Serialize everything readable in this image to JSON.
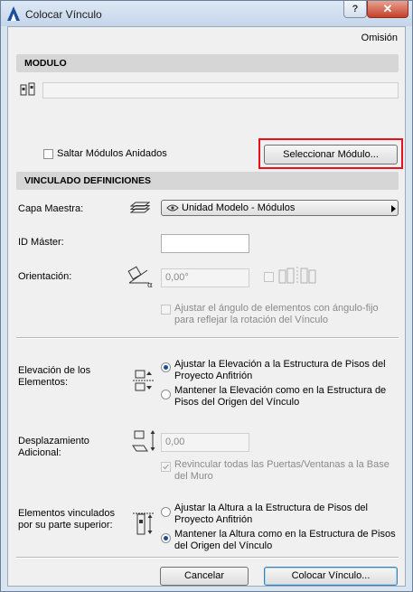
{
  "window": {
    "title": "Colocar Vínculo",
    "help_label": "?",
    "close_label": "✕"
  },
  "omision": "Omisión",
  "modulo": {
    "header": "MODULO",
    "skip_nested_label": "Saltar Módulos Anidados",
    "select_button": "Seleccionar Módulo..."
  },
  "vinculado": {
    "header": "VINCULADO DEFINICIONES",
    "capa_label": "Capa Maestra:",
    "capa_value": "Unidad Modelo - Módulos",
    "id_label": "ID Máster:",
    "id_value": "",
    "orient_label": "Orientación:",
    "orient_value": "0,00°",
    "adjust_angle_label": "Ajustar el ángulo de elementos con ángulo-fijo para reflejar la rotación del Vínculo",
    "elev_label": "Elevación de los Elementos:",
    "elev_option1": "Ajustar la Elevación a la Estructura de Pisos del Proyecto Anfitrión",
    "elev_option2": "Mantener la Elevación como en la Estructura de Pisos del Origen del Vínculo",
    "despl_label": "Desplazamiento Adicional:",
    "despl_value": "0,00",
    "reconnect_label": "Revincular todas las Puertas/Ventanas a la Base del Muro",
    "top_label": "Elementos vinculados por su parte superior:",
    "top_option1": "Ajustar la Altura a la Estructura de Pisos del Proyecto Anfitrión",
    "top_option2": "Mantener la Altura como en la Estructura de Pisos del Origen del Vínculo"
  },
  "footer": {
    "cancel": "Cancelar",
    "place": "Colocar Vínculo..."
  },
  "colors": {
    "highlight": "#e8101a",
    "accent": "#1b4b94"
  }
}
